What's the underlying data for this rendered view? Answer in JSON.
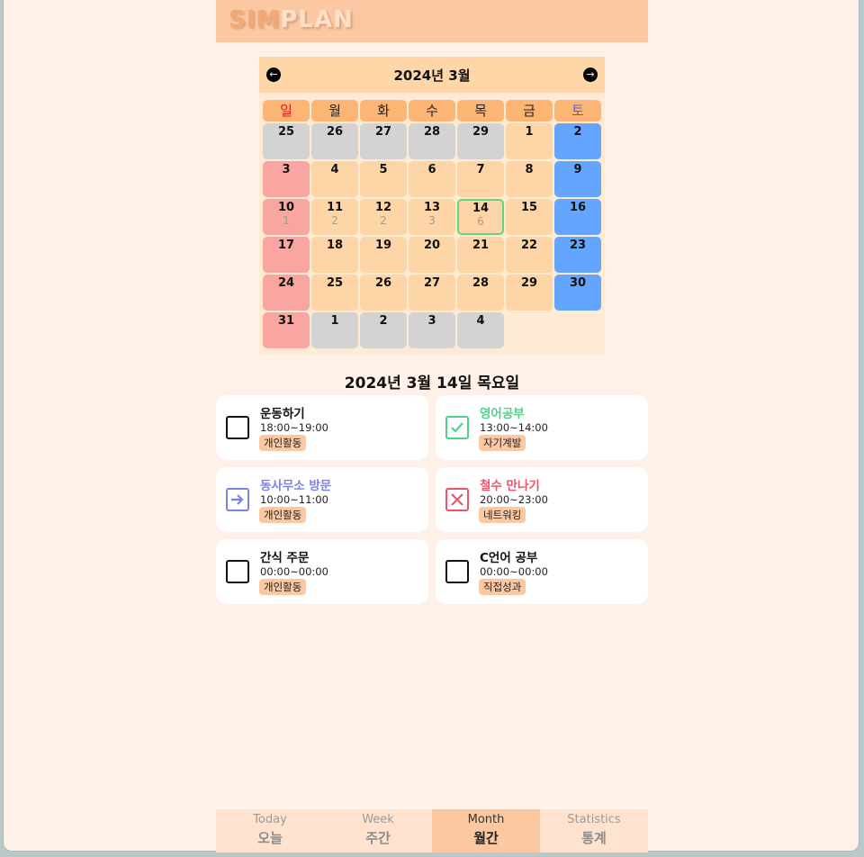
{
  "app": {
    "logo_accent": "SIM",
    "logo_rest": "PLAN"
  },
  "calendar": {
    "title": "2024년 3월",
    "prev_icon": "arrow-left-circle-icon",
    "next_icon": "arrow-right-circle-icon",
    "weekdays": [
      "일",
      "월",
      "화",
      "수",
      "목",
      "금",
      "토"
    ],
    "weekday_colors": [
      "#e0191a",
      "#222222",
      "#222222",
      "#222222",
      "#222222",
      "#222222",
      "#4a61d8"
    ],
    "weeks": [
      [
        {
          "d": "25",
          "t": "other"
        },
        {
          "d": "26",
          "t": "other"
        },
        {
          "d": "27",
          "t": "other"
        },
        {
          "d": "28",
          "t": "other"
        },
        {
          "d": "29",
          "t": "other"
        },
        {
          "d": "1",
          "t": "cur"
        },
        {
          "d": "2",
          "t": "sat"
        }
      ],
      [
        {
          "d": "3",
          "t": "sun"
        },
        {
          "d": "4",
          "t": "cur"
        },
        {
          "d": "5",
          "t": "cur"
        },
        {
          "d": "6",
          "t": "cur"
        },
        {
          "d": "7",
          "t": "cur"
        },
        {
          "d": "8",
          "t": "cur"
        },
        {
          "d": "9",
          "t": "sat"
        }
      ],
      [
        {
          "d": "10",
          "t": "sun",
          "c": "1"
        },
        {
          "d": "11",
          "t": "cur",
          "c": "2"
        },
        {
          "d": "12",
          "t": "cur",
          "c": "2"
        },
        {
          "d": "13",
          "t": "cur",
          "c": "3"
        },
        {
          "d": "14",
          "t": "cur",
          "c": "6",
          "today": true
        },
        {
          "d": "15",
          "t": "cur"
        },
        {
          "d": "16",
          "t": "sat"
        }
      ],
      [
        {
          "d": "17",
          "t": "sun"
        },
        {
          "d": "18",
          "t": "cur"
        },
        {
          "d": "19",
          "t": "cur"
        },
        {
          "d": "20",
          "t": "cur"
        },
        {
          "d": "21",
          "t": "cur"
        },
        {
          "d": "22",
          "t": "cur"
        },
        {
          "d": "23",
          "t": "sat"
        }
      ],
      [
        {
          "d": "24",
          "t": "sun"
        },
        {
          "d": "25",
          "t": "cur"
        },
        {
          "d": "26",
          "t": "cur"
        },
        {
          "d": "27",
          "t": "cur"
        },
        {
          "d": "28",
          "t": "cur"
        },
        {
          "d": "29",
          "t": "cur"
        },
        {
          "d": "30",
          "t": "sat"
        }
      ],
      [
        {
          "d": "31",
          "t": "sun"
        },
        {
          "d": "1",
          "t": "other"
        },
        {
          "d": "2",
          "t": "other"
        },
        {
          "d": "3",
          "t": "other"
        },
        {
          "d": "4",
          "t": "other"
        }
      ]
    ]
  },
  "selected_date": "2024년 3월 14일 목요일",
  "tasks": [
    {
      "title": "운동하기",
      "time": "18:00~19:00",
      "tag": "개인활동",
      "status": "none",
      "color": "#111111",
      "icon": "empty-checkbox-icon"
    },
    {
      "title": "영어공부",
      "time": "13:00~14:00",
      "tag": "자기계발",
      "status": "done",
      "color": "#4bd38a",
      "icon": "check-icon"
    },
    {
      "title": "동사무소 방문",
      "time": "10:00~11:00",
      "tag": "개인활동",
      "status": "deferred",
      "color": "#7a83e6",
      "icon": "arrow-right-icon"
    },
    {
      "title": "철수 만나기",
      "time": "20:00~23:00",
      "tag": "네트워킹",
      "status": "failed",
      "color": "#e9566a",
      "icon": "x-icon"
    },
    {
      "title": "간식 주문",
      "time": "00:00~00:00",
      "tag": "개인활동",
      "status": "none",
      "color": "#111111",
      "icon": "empty-checkbox-icon"
    },
    {
      "title": "C언어 공부",
      "time": "00:00~00:00",
      "tag": "직접성과",
      "status": "none",
      "color": "#111111",
      "icon": "empty-checkbox-icon"
    }
  ],
  "bottom_tabs": [
    {
      "en": "Today",
      "ko": "오늘"
    },
    {
      "en": "Week",
      "ko": "주간"
    },
    {
      "en": "Month",
      "ko": "월간",
      "active": true
    },
    {
      "en": "Statistics",
      "ko": "통계"
    }
  ]
}
